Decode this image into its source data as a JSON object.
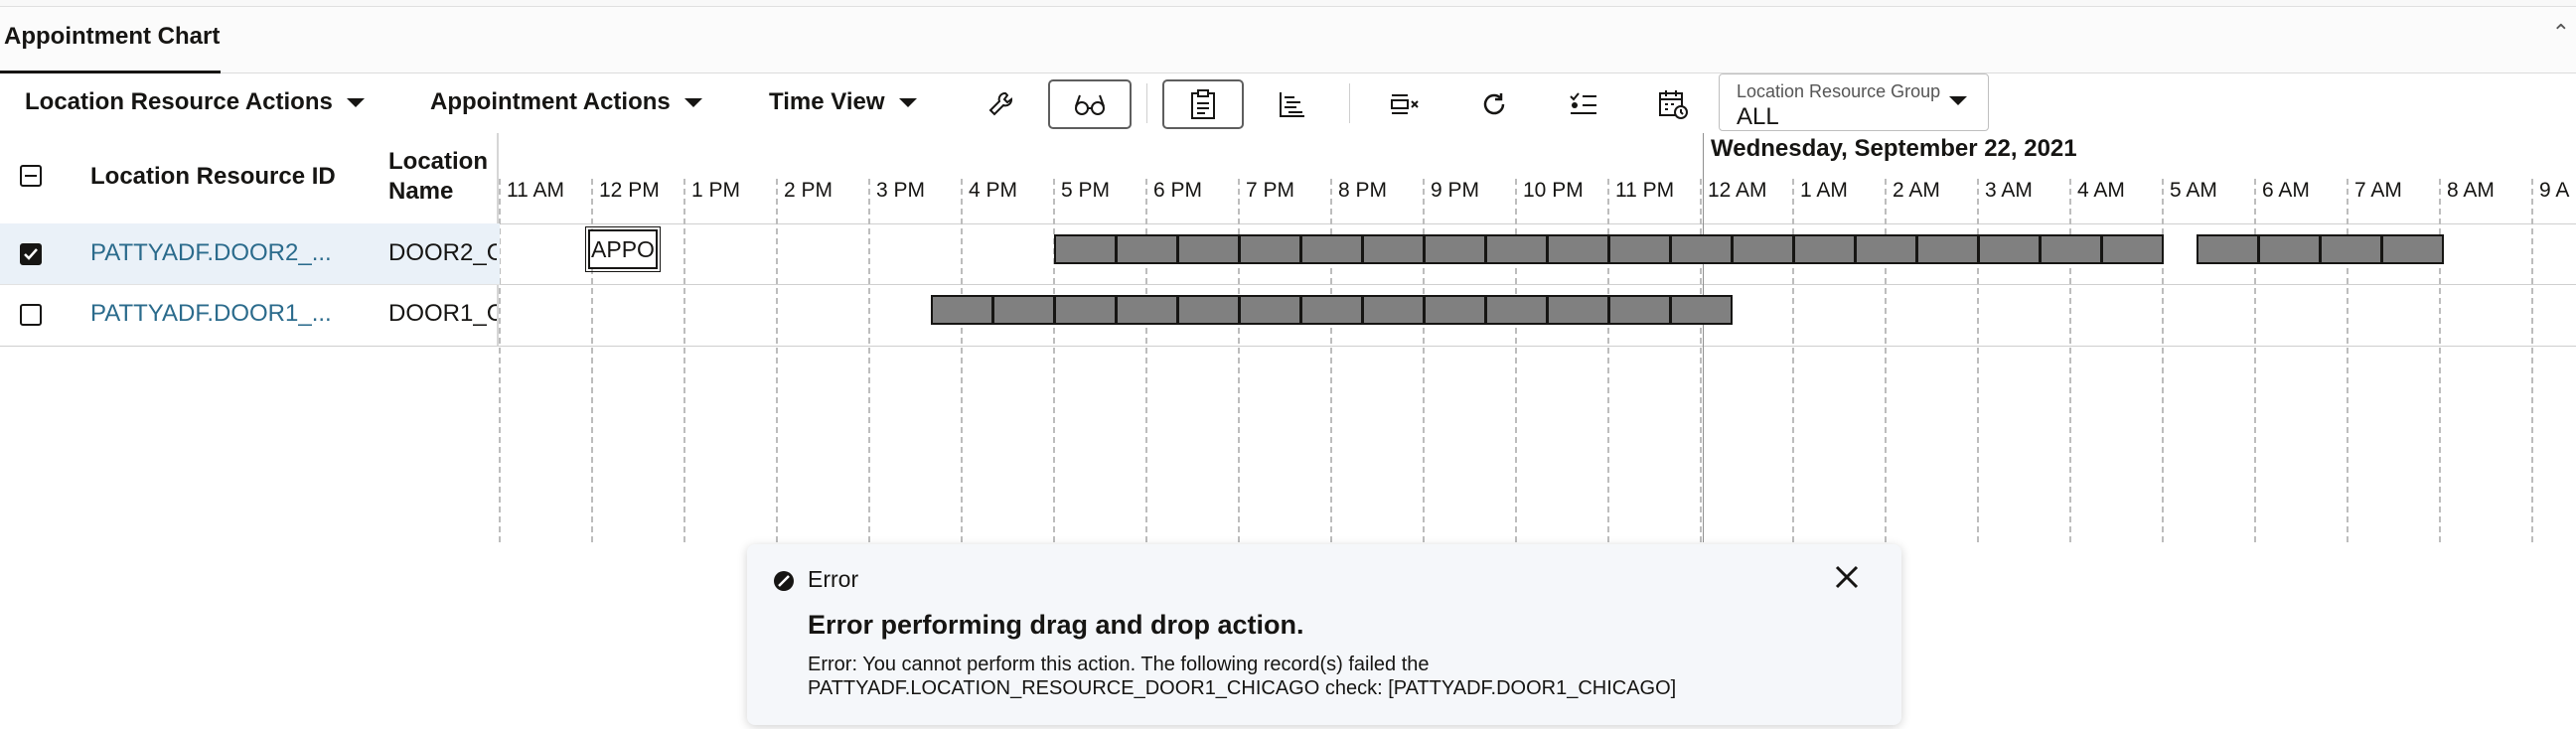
{
  "tabs": {
    "active": "Appointment Chart"
  },
  "toolbar": {
    "menus": [
      "Location Resource Actions",
      "Appointment Actions",
      "Time View"
    ],
    "resource_group": {
      "label": "Location Resource Group",
      "value": "ALL"
    }
  },
  "grid": {
    "col_id": "Location Resource ID",
    "col_name": "Location Name",
    "rows": [
      {
        "id": "PATTYADF.DOOR2_...",
        "name": "DOOR2_C",
        "checked": true
      },
      {
        "id": "PATTYADF.DOOR1_...",
        "name": "DOOR1_C",
        "checked": false
      }
    ]
  },
  "timeline": {
    "date_header": "Wednesday, September 22, 2021",
    "ticks": [
      "11 AM",
      "12 PM",
      "1 PM",
      "2 PM",
      "3 PM",
      "4 PM",
      "5 PM",
      "6 PM",
      "7 PM",
      "8 PM",
      "9 PM",
      "10 PM",
      "11 PM",
      "12 AM",
      "1 AM",
      "2 AM",
      "3 AM",
      "4 AM",
      "5 AM",
      "6 AM",
      "7 AM",
      "8 AM",
      "9 A"
    ],
    "appointment_label": "APPO"
  },
  "error_toast": {
    "type": "Error",
    "title": "Error performing drag and drop action.",
    "line1": "Error: You cannot perform this action. The following record(s) failed the",
    "line2": "PATTYADF.LOCATION_RESOURCE_DOOR1_CHICAGO check: [PATTYADF.DOOR1_CHICAGO]"
  },
  "icons": [
    "wrench-icon",
    "glasses-icon",
    "appointment-list-icon",
    "gantt-icon",
    "clear-rows-icon",
    "refresh-icon",
    "checklist-icon",
    "calendar-clock-icon",
    "close-icon",
    "error-icon"
  ]
}
